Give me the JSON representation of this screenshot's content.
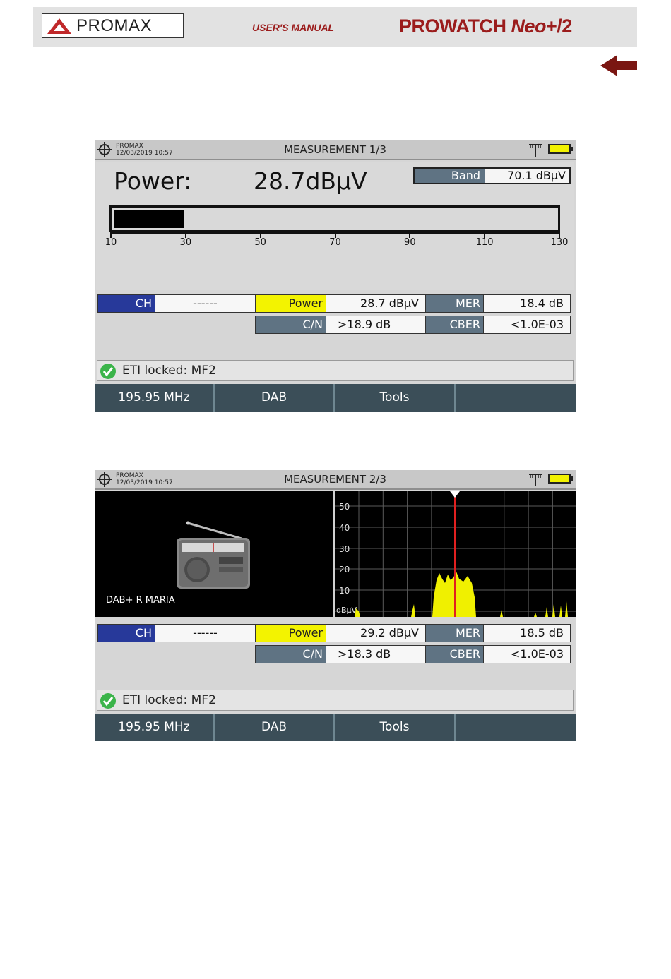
{
  "manual_header": {
    "logo": "PROMAX",
    "manual_label": "USER'S MANUAL",
    "product_main": "PROWATCH",
    "product_neo": "Neo",
    "product_suffix": "+/2"
  },
  "colors": {
    "brand_red": "#9b1c1c",
    "softkey_bg": "#3b4e58",
    "ch_blue": "#27399a",
    "power_yellow": "#f3f300",
    "label_gray": "#5f7383",
    "spectrum_yellow": "#f0f000",
    "marker_red": "#e02020"
  },
  "icons": [
    "back-arrow-icon",
    "crosshair-icon",
    "antenna-icon",
    "battery-icon",
    "check-icon",
    "radio-icon"
  ],
  "screen1": {
    "brand": "PROMAX",
    "datetime": "12/03/2019 10:57",
    "title": "MEASUREMENT 1/3",
    "power_label": "Power:",
    "power_value": "28.7dBµV",
    "band_label": "Band",
    "band_value": "70.1 dBµV",
    "bar_scale": [
      "10",
      "30",
      "50",
      "70",
      "90",
      "110",
      "130"
    ],
    "bar_level": 28.7,
    "bar_min": 10,
    "bar_max": 130,
    "ch_label": "CH",
    "ch_value": "------",
    "power_cell_label": "Power",
    "power_cell_value": "28.7 dBµV",
    "mer_label": "MER",
    "mer_value": "18.4 dB",
    "cn_label": "C/N",
    "cn_value": ">18.9 dB",
    "cber_label": "CBER",
    "cber_value": "<1.0E-03",
    "status": "ETI locked: MF2",
    "softkeys": [
      "195.95 MHz",
      "DAB",
      "Tools",
      ""
    ]
  },
  "screen2": {
    "brand": "PROMAX",
    "datetime": "12/03/2019 10:57",
    "title": "MEASUREMENT 2/3",
    "service_name": "DAB+ R MARIA",
    "spectrum_y_labels": [
      "50",
      "40",
      "30",
      "20",
      "10"
    ],
    "spectrum_unit": "dBµV",
    "ch_label": "CH",
    "ch_value": "------",
    "power_cell_label": "Power",
    "power_cell_value": "29.2 dBµV",
    "mer_label": "MER",
    "mer_value": "18.5 dB",
    "cn_label": "C/N",
    "cn_value": ">18.3 dB",
    "cber_label": "CBER",
    "cber_value": "<1.0E-03",
    "status": "ETI locked: MF2",
    "softkeys": [
      "195.95 MHz",
      "DAB",
      "Tools",
      ""
    ]
  }
}
